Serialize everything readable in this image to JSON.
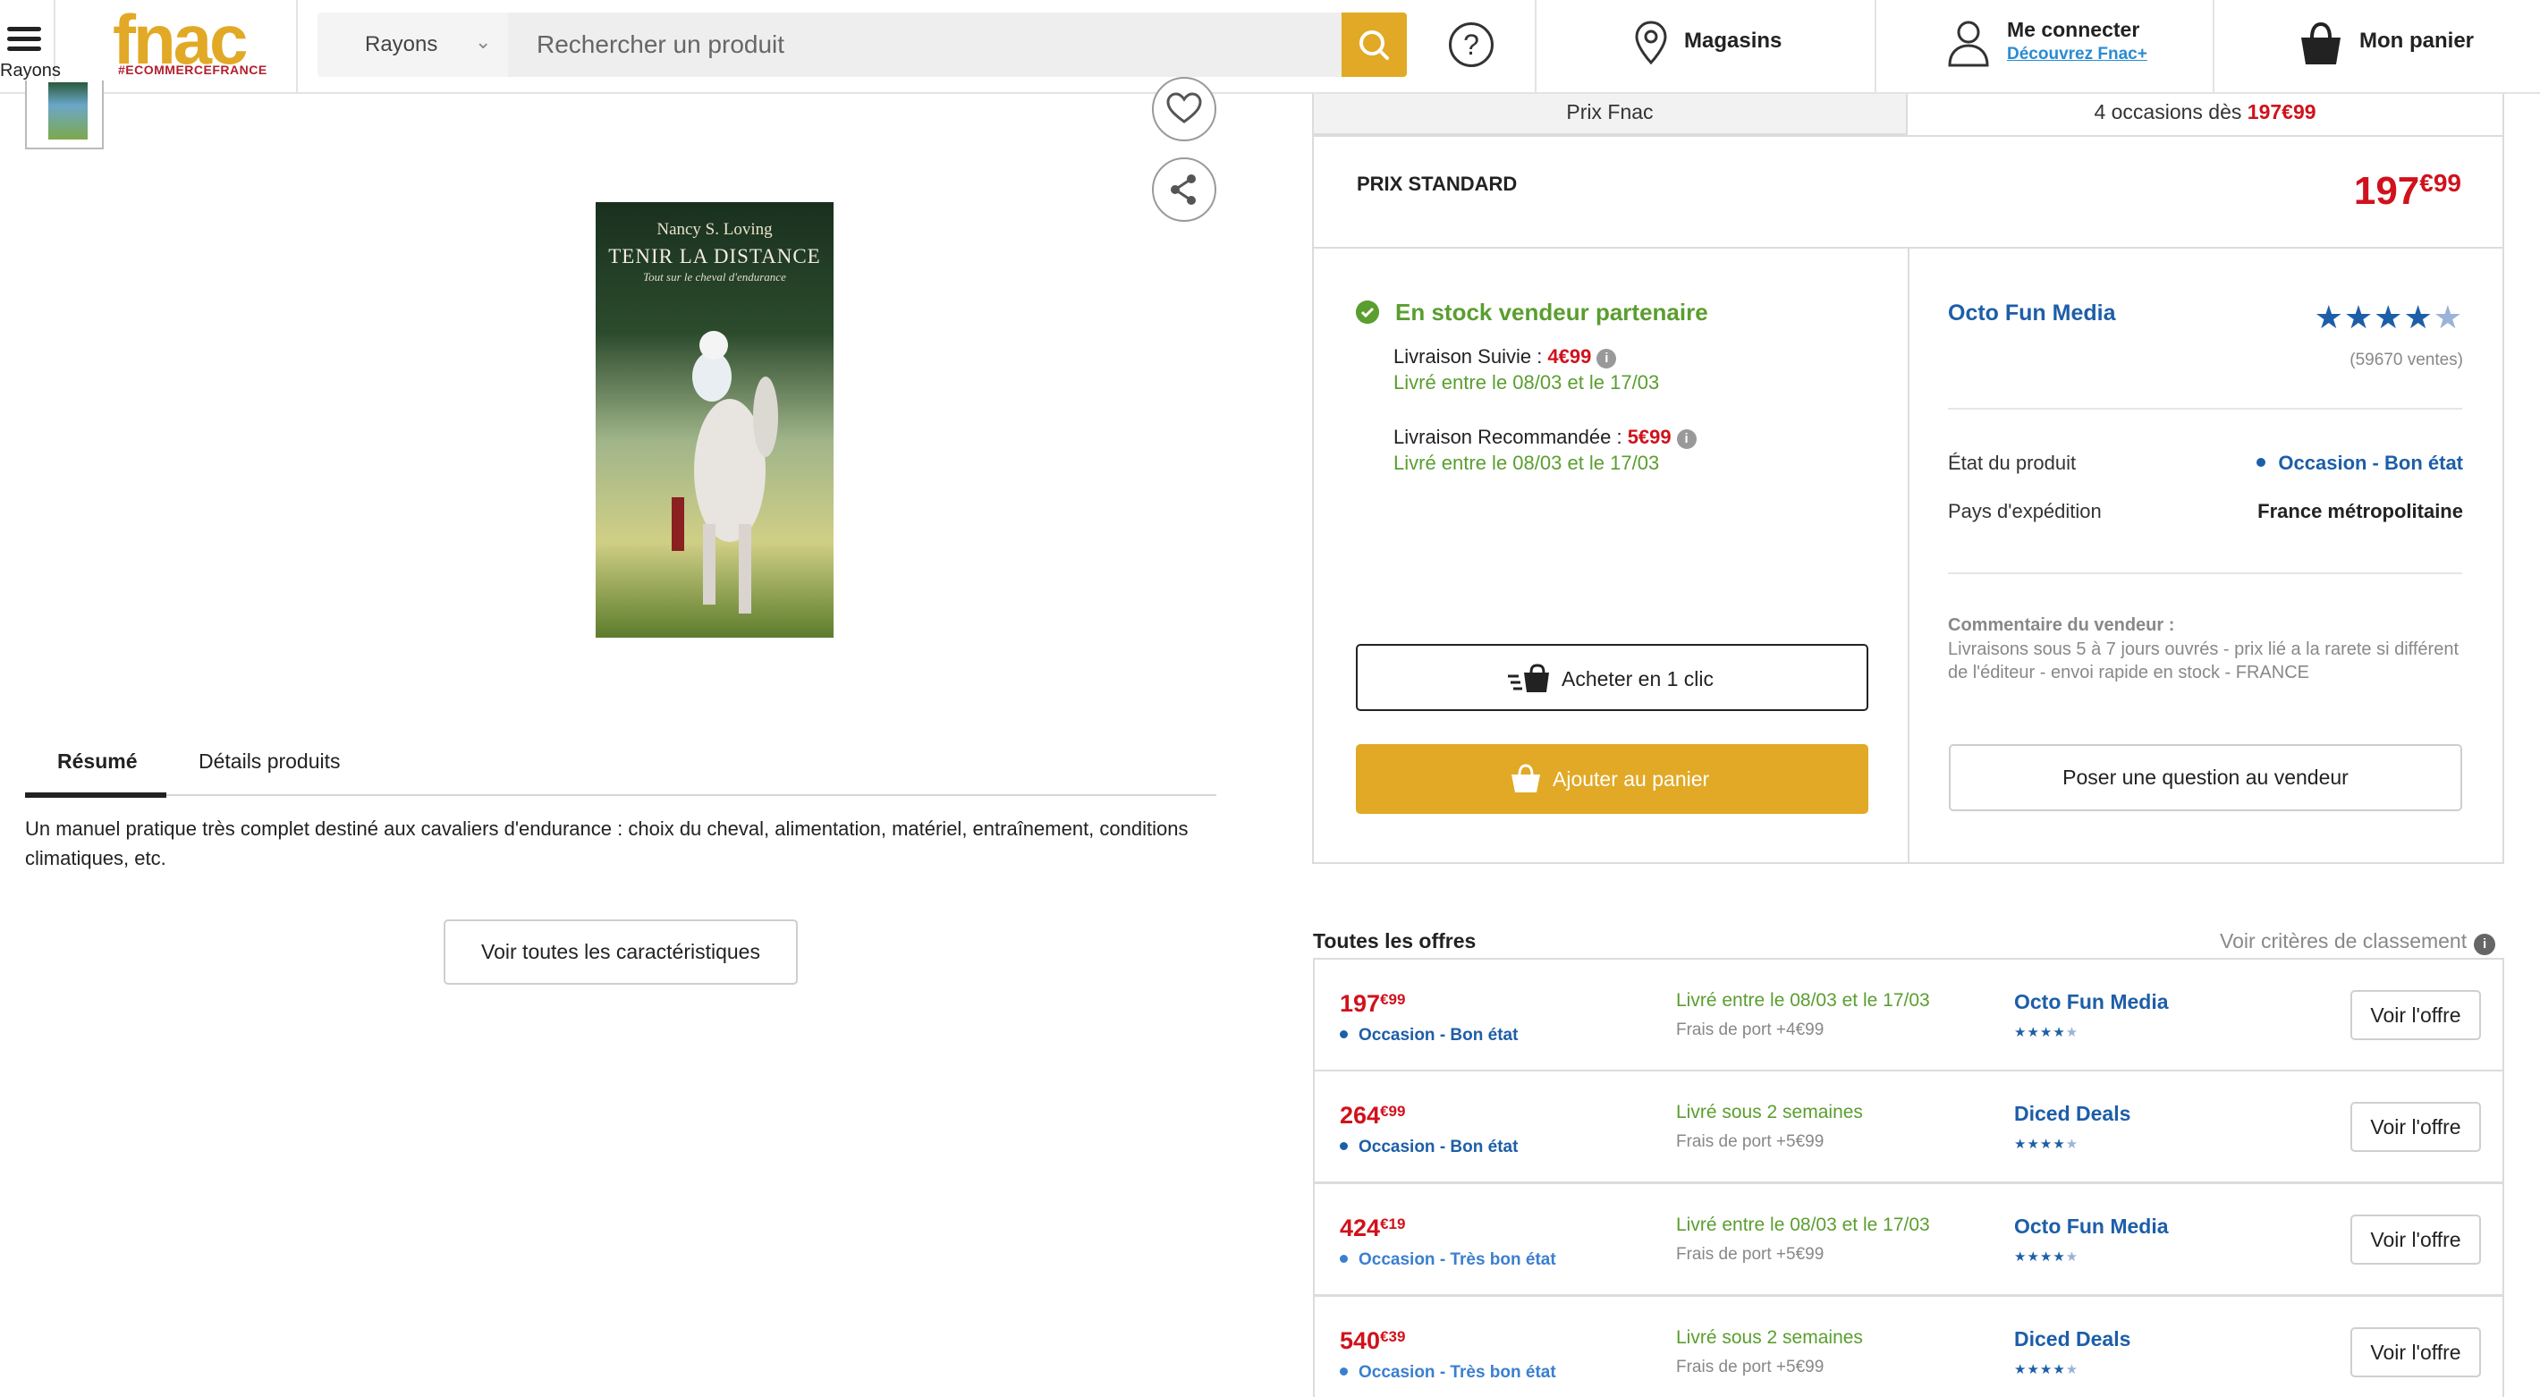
{
  "header": {
    "menu_label": "Rayons",
    "logo_word": "fnac",
    "logo_tagline": "#ECOMMERCEFRANCE",
    "search_category": "Rayons",
    "search_placeholder": "Rechercher un produit",
    "stores_label": "Magasins",
    "account_line1": "Me connecter",
    "account_line2": "Découvrez Fnac+",
    "cart_label": "Mon panier"
  },
  "product": {
    "cover_author": "Nancy S. Loving",
    "cover_title": "TENIR LA DISTANCE",
    "cover_subtitle": "Tout sur le cheval d'endurance",
    "tabs": [
      "Résumé",
      "Détails produits"
    ],
    "summary": "Un manuel pratique très complet destiné aux cavaliers d'endurance : choix du cheval, alimentation, matériel, entraînement, conditions climatiques, etc.",
    "see_all_button": "Voir toutes les caractéristiques"
  },
  "price_tabs": {
    "fnac": "Prix Fnac",
    "occasions_prefix": "4 occasions dès ",
    "occasions_price": "197€99"
  },
  "standard": {
    "label": "PRIX STANDARD",
    "price_int": "197",
    "price_dec": "€99"
  },
  "stock": {
    "status": "En stock vendeur partenaire",
    "delivery1_label": "Livraison Suivie : ",
    "delivery1_price": "4€99",
    "delivery1_date": "Livré entre le 08/03 et le 17/03",
    "delivery2_label": "Livraison Recommandée : ",
    "delivery2_price": "5€99",
    "delivery2_date": "Livré entre le 08/03 et le 17/03",
    "buy_one_click": "Acheter en 1 clic",
    "add_to_cart": "Ajouter au panier"
  },
  "seller": {
    "name": "Octo Fun Media",
    "rating": 4.5,
    "sales": "(59670 ventes)",
    "state_label": "État du produit",
    "state_value": "Occasion - Bon état",
    "country_label": "Pays d'expédition",
    "country_value": "France métropolitaine",
    "comment_title": "Commentaire du vendeur :",
    "comment_body": "Livraisons sous 5 à 7 jours ouvrés - prix lié a la rarete si différent de l'éditeur - envoi rapide en stock - FRANCE",
    "question_button": "Poser une question au vendeur"
  },
  "offers": {
    "title": "Toutes les offres",
    "criteria_link": "Voir critères de classement",
    "button_label": "Voir l'offre",
    "rows": [
      {
        "price_int": "197",
        "price_dec": "€99",
        "condition": "Occasion - Bon état",
        "delivery": "Livré entre le 08/03 et le 17/03",
        "fees": "Frais de port +4€99",
        "seller": "Octo Fun Media",
        "rating": 4.5
      },
      {
        "price_int": "264",
        "price_dec": "€99",
        "condition": "Occasion - Bon état",
        "delivery": "Livré sous 2 semaines",
        "fees": "Frais de port +5€99",
        "seller": "Diced Deals",
        "rating": 4.5
      },
      {
        "price_int": "424",
        "price_dec": "€19",
        "condition": "Occasion - Très bon état",
        "delivery": "Livré entre le 08/03 et le 17/03",
        "fees": "Frais de port +5€99",
        "seller": "Octo Fun Media",
        "rating": 4.5
      },
      {
        "price_int": "540",
        "price_dec": "€39",
        "condition": "Occasion - Très bon état",
        "delivery": "Livré sous 2 semaines",
        "fees": "Frais de port +5€99",
        "seller": "Diced Deals",
        "rating": 4.5
      }
    ]
  },
  "colors": {
    "brand_yellow": "#e1a925",
    "price_red": "#d0121c",
    "seller_blue": "#1d5ea8",
    "stock_green": "#5a9e2f"
  }
}
